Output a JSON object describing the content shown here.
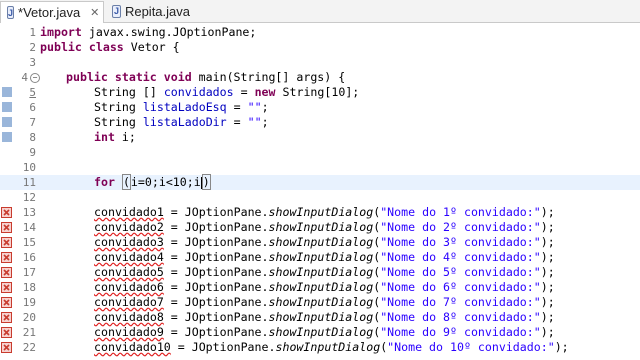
{
  "tabs": [
    {
      "label": "*Vetor.java",
      "close": "✕",
      "active": true
    },
    {
      "label": "Repita.java",
      "active": false
    }
  ],
  "code": {
    "line1": {
      "n": "1",
      "a": "import",
      "b": " javax.swing.JOptionPane;"
    },
    "line2": {
      "n": "2",
      "a": "public",
      "b": " ",
      "c": "class",
      "d": " Vetor {"
    },
    "line3": {
      "n": "3"
    },
    "line4": {
      "n": "4",
      "a": "public",
      "b": " ",
      "c": "static",
      "d": " ",
      "e": "void",
      "f": " main(String[] args) {"
    },
    "line5": {
      "n": "5",
      "a": "String [] ",
      "b": "convidados",
      "c": " = ",
      "d": "new",
      "e": " String[10];"
    },
    "line6": {
      "n": "6",
      "a": "String ",
      "b": "listaLadoEsq",
      "c": " = ",
      "d": "\"\"",
      "e": ";"
    },
    "line7": {
      "n": "7",
      "a": "String ",
      "b": "listaLadoDir",
      "c": " = ",
      "d": "\"\"",
      "e": ";"
    },
    "line8": {
      "n": "8",
      "a": "int",
      "b": " i;"
    },
    "line9": {
      "n": "9"
    },
    "line10": {
      "n": "10"
    },
    "line11": {
      "n": "11",
      "a": "for",
      "b": " ",
      "c": "(",
      "d": "i=0;i<10;i",
      "e": ")"
    },
    "line12": {
      "n": "12"
    },
    "calls": [
      {
        "n": "13",
        "var": "convidado1",
        "str": "\"Nome do 1º convidado:\""
      },
      {
        "n": "14",
        "var": "convidado2",
        "str": "\"Nome do 2º convidado:\""
      },
      {
        "n": "15",
        "var": "convidado3",
        "str": "\"Nome do 3º convidado:\""
      },
      {
        "n": "16",
        "var": "convidado4",
        "str": "\"Nome do 4º convidado:\""
      },
      {
        "n": "17",
        "var": "convidado5",
        "str": "\"Nome do 5º convidado:\""
      },
      {
        "n": "18",
        "var": "convidado6",
        "str": "\"Nome do 6º convidado:\""
      },
      {
        "n": "19",
        "var": "convidado7",
        "str": "\"Nome do 7º convidado:\""
      },
      {
        "n": "20",
        "var": "convidado8",
        "str": "\"Nome do 8º convidado:\""
      },
      {
        "n": "21",
        "var": "convidado9",
        "str": "\"Nome do 9º convidado:\""
      },
      {
        "n": "22",
        "var": "convidado10",
        "str": "\"Nome do 10º convidado:\""
      }
    ],
    "call_mid": " = JOptionPane.",
    "call_method": "showInputDialog",
    "call_open": "(",
    "call_end": ");"
  },
  "colors": {
    "keyword": "#7f0055",
    "string": "#2a00ff",
    "field": "#0000c0",
    "error": "#e02020"
  },
  "icons": {
    "tab_file": "java-file-icon",
    "error_marker": "error-marker-icon",
    "warning_marker": "warning-marker-icon"
  }
}
